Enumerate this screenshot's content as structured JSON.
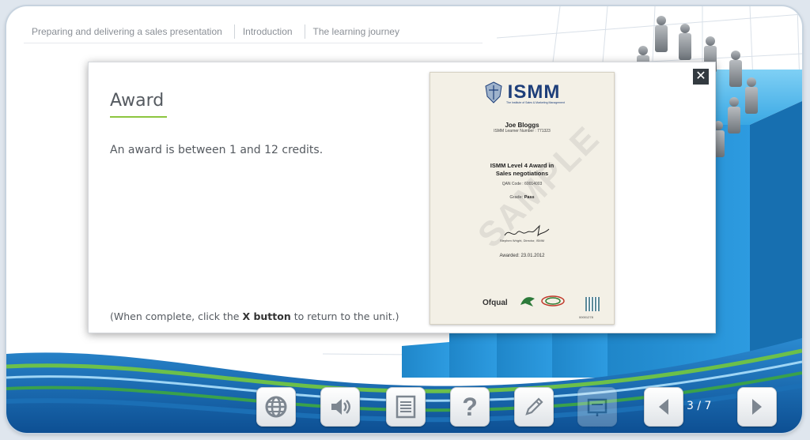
{
  "breadcrumb": {
    "items": [
      "Preparing and delivering a sales presentation",
      "Introduction",
      "The learning journey"
    ]
  },
  "modal": {
    "title": "Award",
    "body": "An award is between 1 and 12 credits.",
    "footer_pre": "(When complete, click the ",
    "footer_bold": "X button",
    "footer_post": " to return to the unit.)",
    "close_label": "✕"
  },
  "certificate": {
    "brand": "ISMM",
    "brand_sub": "The Institute of Sales & Marketing Management",
    "name": "Joe Bloggs",
    "learner": "ISMM Learner Number : 771323",
    "award_line1": "ISMM Level 4 Award in",
    "award_line2": "Sales negotiations",
    "qan": "QAN Code : 60014003",
    "grade_label": "Grade: ",
    "grade_value": "Pass",
    "signatory": "Stephen Wright, Director, ISMM",
    "date": "Awarded: 23.01.2012",
    "watermark": "SAMPLE",
    "ofqual": "Ofqual",
    "code": "00001278"
  },
  "toolbar": {
    "buttons": [
      {
        "name": "glossary",
        "icon": "globe-icon"
      },
      {
        "name": "audio",
        "icon": "speaker-icon"
      },
      {
        "name": "transcript",
        "icon": "document-icon"
      },
      {
        "name": "help",
        "icon": "question-icon",
        "label": "?"
      },
      {
        "name": "notes",
        "icon": "pencil-icon"
      },
      {
        "name": "resources",
        "icon": "presentation-icon",
        "disabled": true
      },
      {
        "name": "previous",
        "icon": "triangle-left-icon"
      },
      {
        "name": "next",
        "icon": "triangle-right-icon"
      }
    ],
    "page_counter": "3 / 7"
  },
  "colors": {
    "accent_green": "#8cc63f",
    "brand_blue": "#1e3f7a",
    "wave_blue": "#1b6fb5",
    "wave_green": "#3aa14b"
  }
}
